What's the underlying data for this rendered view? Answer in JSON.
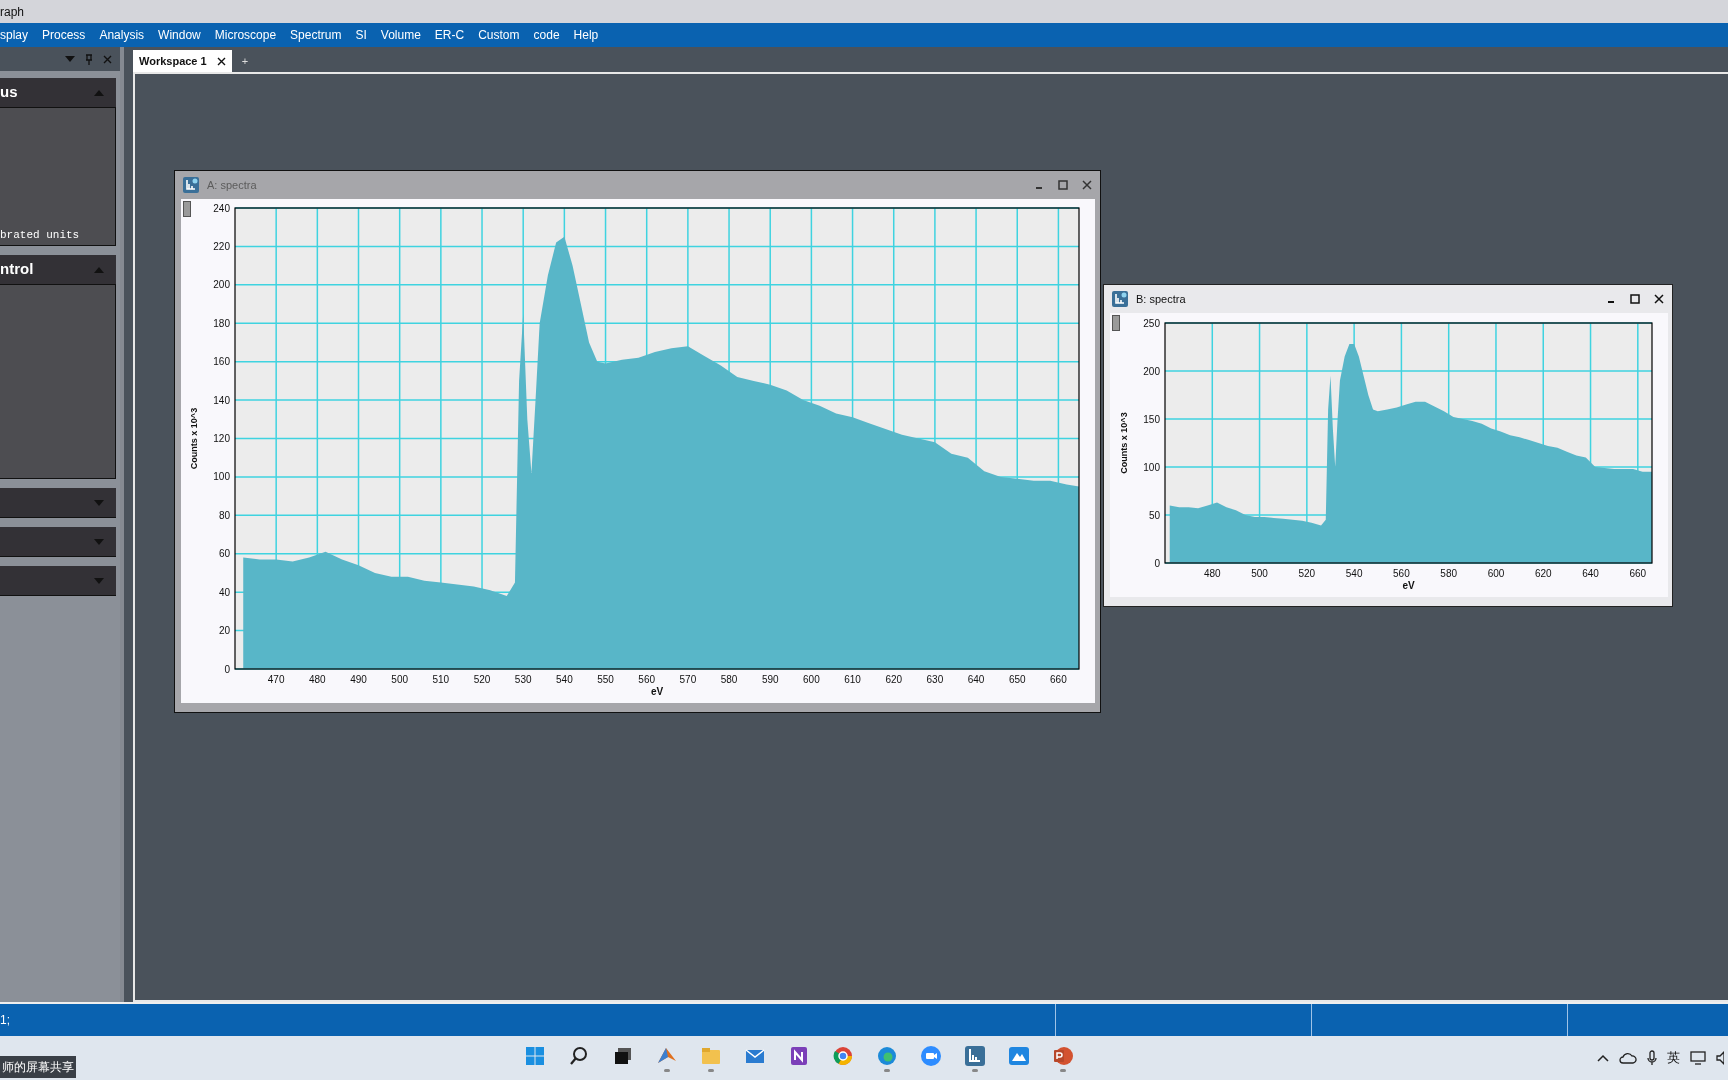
{
  "title_bar": {
    "title": "raph"
  },
  "menu": [
    "splay",
    "Process",
    "Analysis",
    "Window",
    "Microscope",
    "Spectrum",
    "SI",
    "Volume",
    "ER-C",
    "Custom",
    "code",
    "Help"
  ],
  "panel": {
    "sections": [
      {
        "title": "us",
        "expanded": true,
        "lines": [
          "brated units"
        ]
      },
      {
        "title": "ntrol",
        "expanded": true
      },
      {
        "expanded": false
      },
      {
        "expanded": false
      },
      {
        "expanded": false
      }
    ]
  },
  "workspace": {
    "tabs": [
      {
        "label": "Workspace 1",
        "selected": true
      }
    ],
    "new_tab": "+",
    "windows": [
      {
        "title": "A: spectra",
        "active": false,
        "chart_data": {
          "type": "area",
          "xlabel": "eV",
          "ylabel": "Counts x 10^3",
          "x": [
            462,
            466,
            470,
            474,
            478,
            482,
            486,
            490,
            494,
            498,
            502,
            506,
            510,
            514,
            518,
            522,
            526,
            528,
            529,
            530,
            531,
            532,
            533,
            534,
            536,
            538,
            540,
            542,
            544,
            546,
            548,
            550,
            554,
            558,
            562,
            566,
            570,
            574,
            578,
            582,
            586,
            590,
            594,
            598,
            602,
            606,
            610,
            614,
            618,
            622,
            626,
            630,
            634,
            638,
            642,
            646,
            650,
            654,
            658,
            662,
            665
          ],
          "grid": true,
          "series": [
            {
              "color": "#58b6c8",
              "values": [
                58,
                57,
                57,
                56,
                58,
                61,
                57,
                54,
                50,
                48,
                48,
                46,
                45,
                44,
                43,
                41,
                38,
                45,
                150,
                185,
                130,
                102,
                140,
                180,
                205,
                222,
                225,
                210,
                190,
                170,
                160,
                159,
                161,
                162,
                165,
                167,
                168,
                163,
                158,
                152,
                150,
                148,
                145,
                140,
                137,
                133,
                131,
                128,
                125,
                122,
                120,
                118,
                112,
                110,
                103,
                100,
                99,
                98,
                98,
                96,
                95
              ]
            }
          ],
          "xlim": [
            460,
            665
          ],
          "ylim": [
            0,
            240
          ],
          "xticks": [
            470,
            480,
            490,
            500,
            510,
            520,
            530,
            540,
            550,
            560,
            570,
            580,
            590,
            600,
            610,
            620,
            630,
            640,
            650,
            660
          ],
          "yticks": [
            0,
            20,
            40,
            60,
            80,
            100,
            120,
            140,
            160,
            180,
            200,
            220,
            240
          ]
        }
      },
      {
        "title": "B: spectra",
        "active": true,
        "chart_data": {
          "type": "area",
          "xlabel": "eV",
          "ylabel": "Counts x 10^3",
          "x": [
            462,
            466,
            470,
            474,
            478,
            482,
            486,
            490,
            494,
            498,
            502,
            506,
            510,
            514,
            518,
            522,
            526,
            528,
            529,
            530,
            531,
            532,
            533,
            534,
            536,
            538,
            540,
            542,
            544,
            546,
            548,
            550,
            554,
            558,
            562,
            566,
            570,
            574,
            578,
            582,
            586,
            590,
            594,
            598,
            602,
            606,
            610,
            614,
            618,
            622,
            626,
            630,
            634,
            638,
            642,
            646,
            650,
            654,
            658,
            662,
            666
          ],
          "grid": true,
          "series": [
            {
              "color": "#58b6c8",
              "values": [
                60,
                58,
                58,
                57,
                60,
                63,
                58,
                55,
                50,
                48,
                48,
                47,
                46,
                45,
                44,
                42,
                39,
                45,
                160,
                195,
                140,
                100,
                150,
                190,
                215,
                228,
                228,
                215,
                195,
                175,
                160,
                158,
                160,
                162,
                165,
                168,
                168,
                163,
                158,
                152,
                150,
                148,
                145,
                140,
                137,
                133,
                131,
                128,
                125,
                122,
                120,
                116,
                112,
                110,
                100,
                99,
                98,
                98,
                98,
                95,
                95
              ]
            }
          ],
          "xlim": [
            460,
            666
          ],
          "ylim": [
            0,
            250
          ],
          "xticks": [
            480,
            500,
            520,
            540,
            560,
            580,
            600,
            620,
            640,
            660
          ],
          "yticks": [
            0,
            50,
            100,
            150,
            200,
            250
          ]
        }
      }
    ]
  },
  "status_bar": {
    "text": "1;"
  },
  "screen_share_label": "师的屏幕共享",
  "tray": {
    "input_method": "英"
  }
}
